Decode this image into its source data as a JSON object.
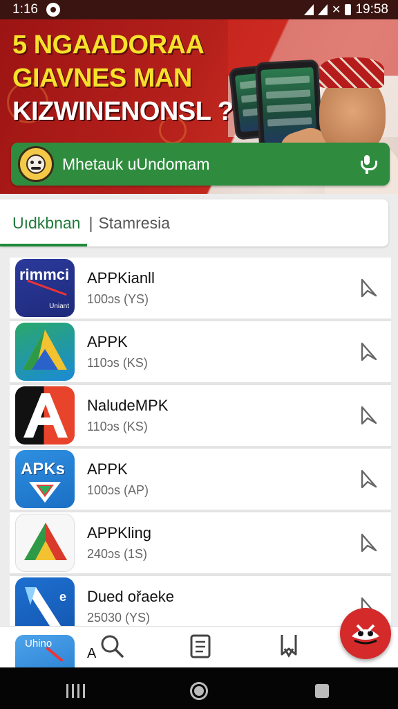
{
  "status": {
    "time": "1:16",
    "clock": "19:58"
  },
  "banner": {
    "line1": "5 NGAADORAA",
    "line2": "GIAVNES MAN",
    "line3": "KIZWINENONSL ?"
  },
  "search": {
    "text": "Mhetauk uUndomam",
    "mic_icon": "mic-icon"
  },
  "tabs": {
    "active": "Uıdkbnan",
    "separator": "|",
    "other": "Stamresia"
  },
  "apps": [
    {
      "name": "APPKianll",
      "meta": "100ɔs  (YS)",
      "icon_text": "rimmci",
      "icon_sub": "Uniant"
    },
    {
      "name": "APPK",
      "meta": "110ɔs  (KS)"
    },
    {
      "name": "NaludeMPK",
      "meta": "110ɔs  (KS)"
    },
    {
      "name": "APPK",
      "meta": "100ɔs  (AP)",
      "icon_text": "APKs"
    },
    {
      "name": "APPKling",
      "meta": "240ɔs  (1S)"
    },
    {
      "name": "Dued ořaeke",
      "meta": "25030  (YS)",
      "icon_text": "e"
    }
  ],
  "bottom": {
    "partial_icon_text": "Uhino",
    "partial_label": "A"
  },
  "colors": {
    "accent": "#1f8a3a",
    "banner": "#b5201b",
    "fab": "#d42a2a"
  }
}
